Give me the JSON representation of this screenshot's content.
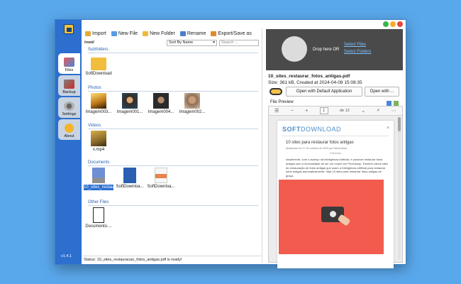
{
  "app": {
    "version": "v1.4.1"
  },
  "sidebar": {
    "items": [
      {
        "label": "Files"
      },
      {
        "label": "Backup"
      },
      {
        "label": "Settings"
      },
      {
        "label": "About"
      }
    ]
  },
  "toolbar": {
    "import_label": "Import",
    "new_file_label": "New File",
    "new_folder_label": "New Folder",
    "rename_label": "Rename",
    "export_label": "Export/Save as"
  },
  "pathbar": {
    "path": "/root/",
    "sort_value": "Sort By Name",
    "search_placeholder": "Search ..."
  },
  "sections": {
    "subfolders": "Subfolders",
    "photos": "Photos",
    "videos": "Videos",
    "documents": "Documents",
    "other": "Other Files"
  },
  "files": {
    "subfolders": [
      {
        "label": "SoftDownload"
      }
    ],
    "photos": [
      {
        "label": "Imagem003..."
      },
      {
        "label": "Imagem001..."
      },
      {
        "label": "Imagem004..."
      },
      {
        "label": "Imagem002..."
      }
    ],
    "videos": [
      {
        "label": "x.mp4"
      }
    ],
    "documents": [
      {
        "label": "10_sites_restaurar_fotos_antig"
      },
      {
        "label": "SoftDownloa..."
      },
      {
        "label": "SoftDownloa..."
      }
    ],
    "other": [
      {
        "label": "Documento...."
      }
    ]
  },
  "status": {
    "text": "Status: 10_sites_restauracao_fotos_antigas.pdf is ready!"
  },
  "dropzone": {
    "text": "Drop here OR",
    "select_files": "Select Files",
    "select_folders": "Select Folders"
  },
  "details": {
    "file_name": "10_sites_restaurar_fotos_antigas.pdf",
    "meta": "Size: 361 kB, Created at 2024-04-08 15:08:35",
    "open_default": "Open with Default Application",
    "open_with": "Open with ..."
  },
  "preview": {
    "title": "File Preview",
    "page_current": "1",
    "page_total": "de 12",
    "pdf": {
      "logo_bold": "SOFT",
      "logo_rest": "DOWNLOAD",
      "heading": "10 sites para restaurar fotos antigas",
      "sub": "Atualizado em 17 de outubro de 2023 por Sarah Alves",
      "small": "Publicidade",
      "body": "Atualmente, com o avanço da Inteligência Artificial, é possível restaurar fotos antigas sem a necessidade de ser um expert em Photoshop. Existem vários sites de restauração de fotos antigas que usam a Inteligência artificial para restaurar fotos antigas automaticamente. Veja 10 sites para restaurar fotos antigas de graça."
    }
  },
  "colors": {
    "background": "#5aa8ec",
    "rail": "#2c6fce",
    "accent": "#2b6fd0",
    "dropzone": "#4a4a4a",
    "pdf_image": "#f25c4f"
  }
}
